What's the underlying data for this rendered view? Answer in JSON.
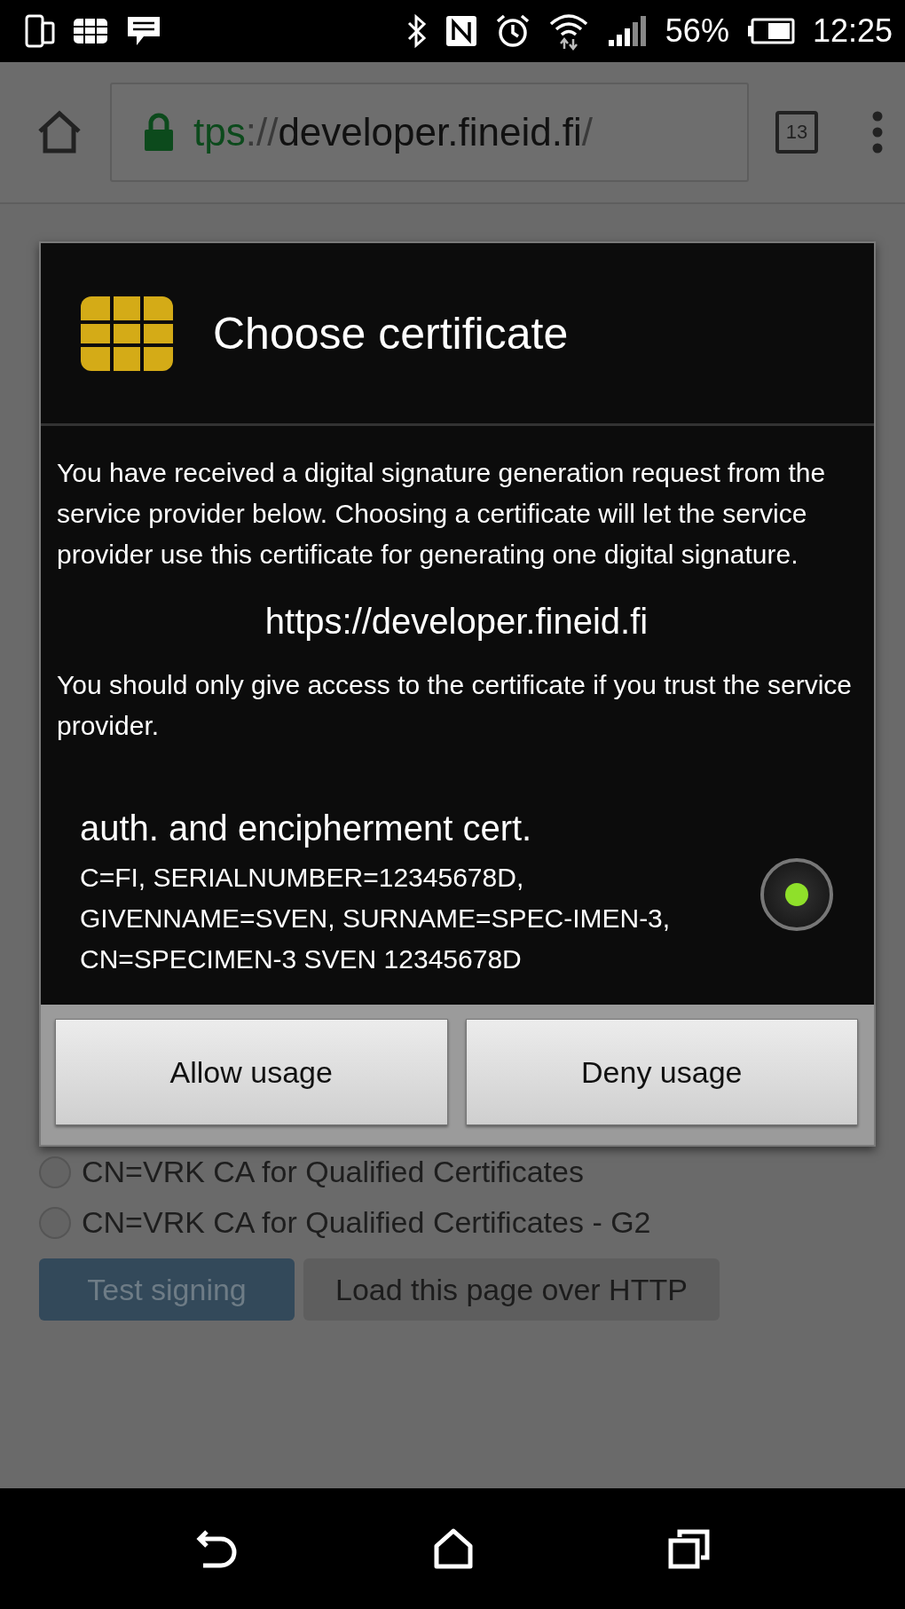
{
  "status_bar": {
    "battery": "56%",
    "time": "12:25"
  },
  "browser": {
    "url_scheme": "tps",
    "url_separator": "://",
    "url_host": "developer.fineid.fi",
    "url_path": "/",
    "tab_count": "13"
  },
  "dialog": {
    "title": "Choose certificate",
    "message": "You have received a digital signature generation request from the service provider below. Choosing a certificate will let the service provider use this certificate for generating one digital signature.",
    "origin": "https://developer.fineid.fi",
    "warning": "You should only give access to the certificate if you trust the service provider.",
    "certificates": [
      {
        "title": "auth. and encipherment cert.",
        "details": "C=FI, SERIALNUMBER=12345678D, GIVENNAME=SVEN, SURNAME=SPEC-IMEN-3, CN=SPECIMEN-3 SVEN 12345678D",
        "selected": true
      }
    ],
    "buttons": [
      {
        "label": "Allow usage"
      },
      {
        "label": "Deny usage"
      }
    ]
  },
  "page": {
    "options": [
      {
        "label": "CN=VRK CA for Qualified Certificates",
        "selected": false
      },
      {
        "label": "CN=VRK CA for Qualified Certificates - G2",
        "selected": false
      }
    ],
    "buttons": [
      {
        "label": "Test signing",
        "kind": "primary"
      },
      {
        "label": "Load this page over HTTP",
        "kind": "secondary"
      }
    ]
  }
}
